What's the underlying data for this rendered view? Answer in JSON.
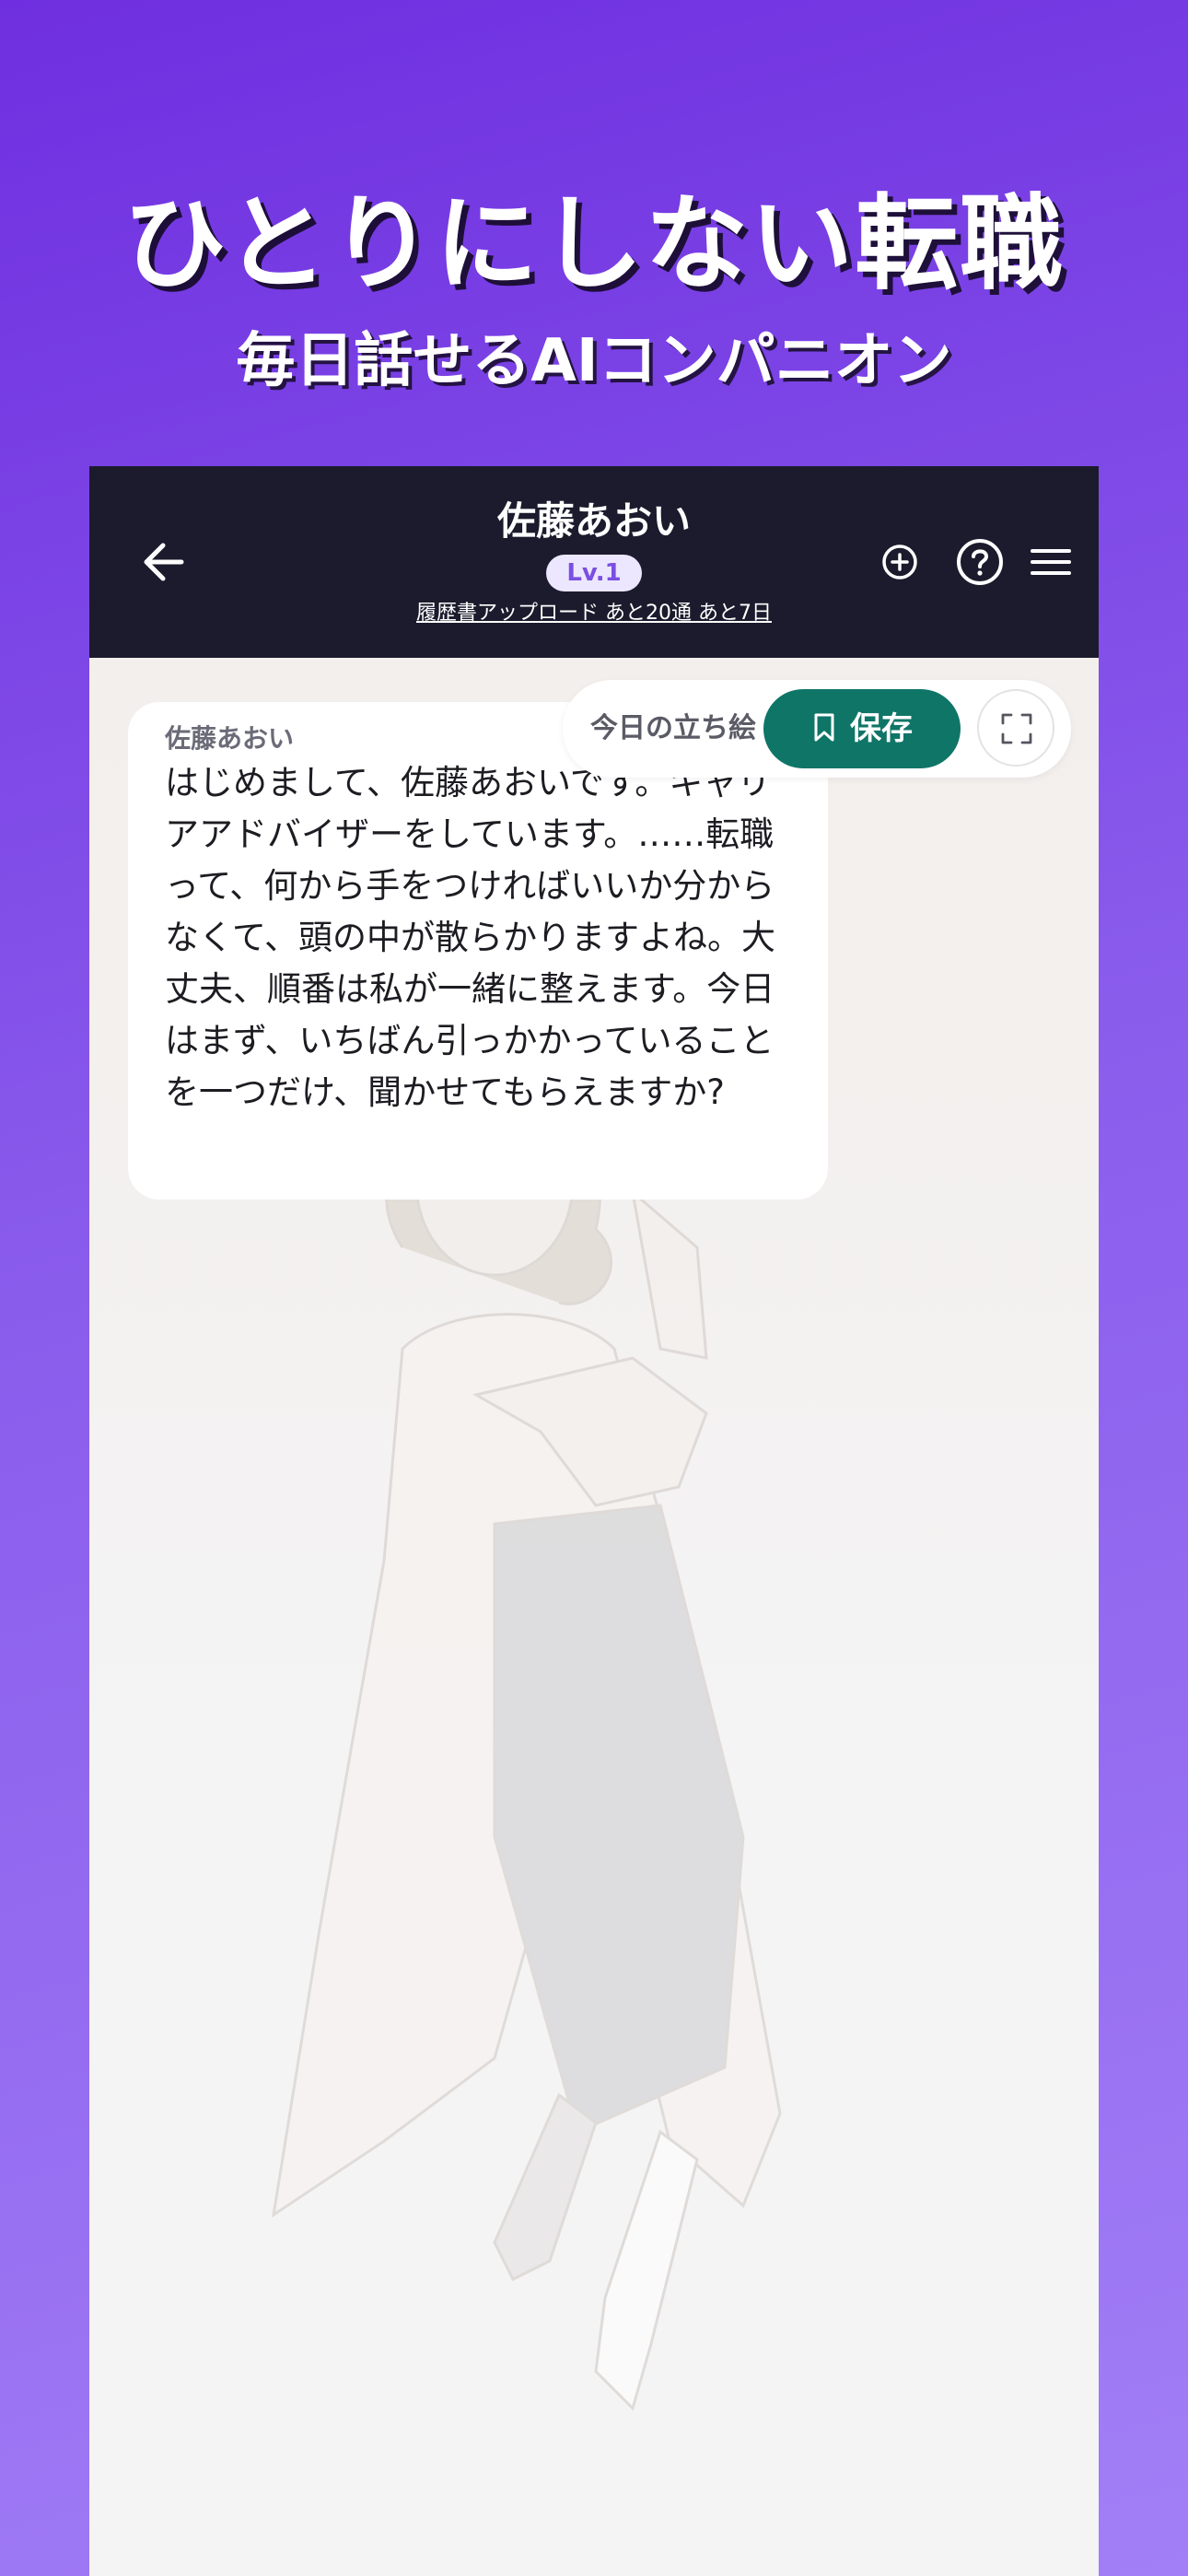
{
  "hero": {
    "title": "ひとりにしない転職",
    "subtitle": "毎日話せるAIコンパニオン"
  },
  "header": {
    "character_name": "佐藤あおい",
    "level": "Lv.1",
    "upload_link": "履歴書アップロード あと20通 あと7日",
    "icons": [
      "back-arrow-icon",
      "plus-circle-icon",
      "question-circle-icon",
      "hamburger-menu-icon"
    ]
  },
  "portrait_toolbar": {
    "label": "今日の立ち絵",
    "save_label": "保存",
    "icons": [
      "bookmark-icon",
      "expand-icon"
    ]
  },
  "message": {
    "sender": "佐藤あおい",
    "text": "はじめまして、佐藤あおいです。キャリアアドバイザーをしています。……転職って、何から手をつければいいか分からなくて、頭の中が散らかりますよね。大丈夫、順番は私が一緒に整えます。今日はまず、いちばん引っかかっていることを一つだけ、聞かせてもらえますか?"
  },
  "colors": {
    "background_top": "#6f2fe0",
    "background_bottom": "#a27ff6",
    "header_bg": "#1b1b2d",
    "accent_green": "#0f7567",
    "badge_text": "#7b4fe0"
  }
}
